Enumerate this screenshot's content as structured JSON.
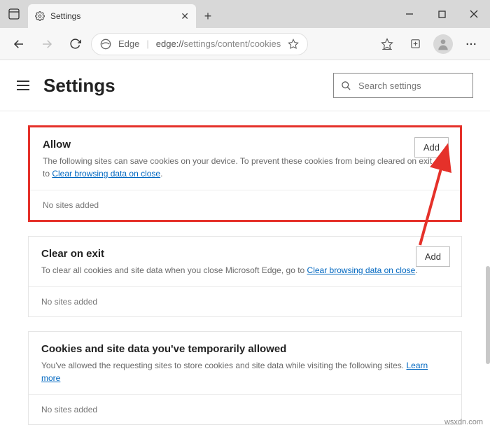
{
  "window": {
    "tab_title": "Settings",
    "new_tab": "+",
    "minimize": "—",
    "maximize": "▢",
    "close": "✕"
  },
  "toolbar": {
    "edge_label": "Edge",
    "url_prefix": "edge://",
    "url_path": "settings/content/cookies"
  },
  "page": {
    "title": "Settings",
    "search_placeholder": "Search settings"
  },
  "cards": {
    "allow": {
      "title": "Allow",
      "desc_pre": "The following sites can save cookies on your device. To prevent these cookies from being cleared on exit, go to ",
      "link": "Clear browsing data on close",
      "desc_post": ".",
      "add": "Add",
      "empty": "No sites added"
    },
    "clear": {
      "title": "Clear on exit",
      "desc_pre": "To clear all cookies and site data when you close Microsoft Edge, go to ",
      "link": "Clear browsing data on close",
      "desc_post": ".",
      "add": "Add",
      "empty": "No sites added"
    },
    "temp": {
      "title": "Cookies and site data you've temporarily allowed",
      "desc_pre": "You've allowed the requesting sites to store cookies and site data while visiting the following sites. ",
      "link": "Learn more",
      "desc_post": "",
      "empty": "No sites added"
    }
  },
  "watermark": "wsxdn.com"
}
